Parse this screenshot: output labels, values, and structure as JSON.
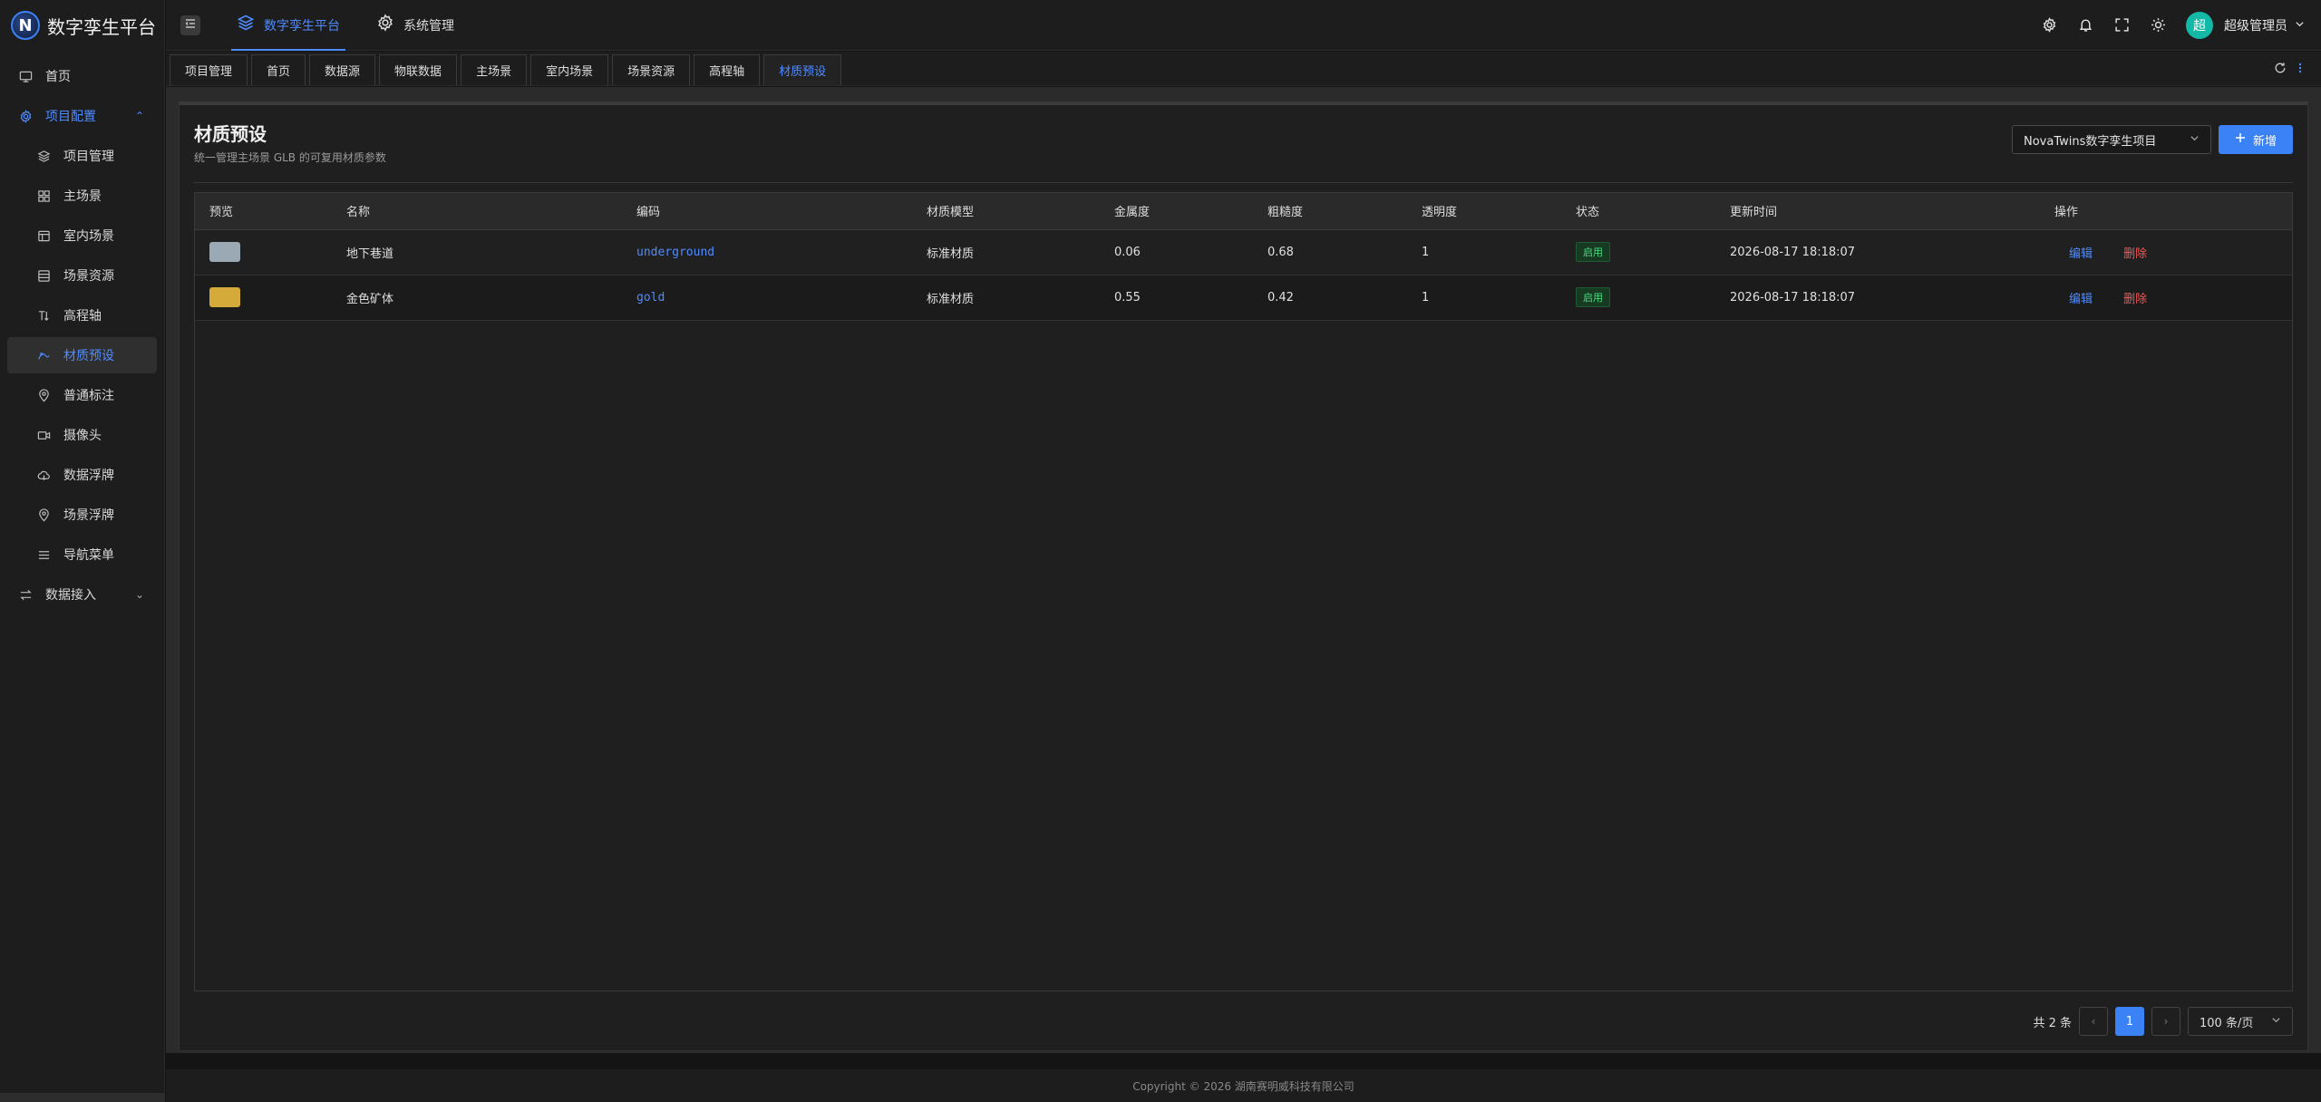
{
  "app": {
    "logo_letter": "N",
    "title": "数字孪生平台"
  },
  "sidebar": {
    "items": [
      {
        "label": "首页",
        "icon": "monitor-icon"
      },
      {
        "label": "项目配置",
        "icon": "gear-icon",
        "expanded": true,
        "arrow": "⌃"
      },
      {
        "label": "项目管理",
        "icon": "layers-icon"
      },
      {
        "label": "主场景",
        "icon": "grid-icon"
      },
      {
        "label": "室内场景",
        "icon": "building-icon"
      },
      {
        "label": "场景资源",
        "icon": "list-icon"
      },
      {
        "label": "高程轴",
        "icon": "elevation-icon"
      },
      {
        "label": "材质预设",
        "icon": "palette-icon"
      },
      {
        "label": "普通标注",
        "icon": "pin-icon"
      },
      {
        "label": "摄像头",
        "icon": "camera-icon"
      },
      {
        "label": "数据浮牌",
        "icon": "cloud-icon"
      },
      {
        "label": "场景浮牌",
        "icon": "pin-icon"
      },
      {
        "label": "导航菜单",
        "icon": "menu-icon"
      },
      {
        "label": "数据接入",
        "icon": "swap-icon",
        "arrow": "⌄"
      }
    ]
  },
  "header": {
    "tabs": [
      {
        "label": "数字孪生平台",
        "icon": "layers-icon"
      },
      {
        "label": "系统管理",
        "icon": "gear-icon"
      }
    ],
    "avatar_text": "超",
    "user_name": "超级管理员",
    "accent": "#3b82f6"
  },
  "page_tabs": [
    "项目管理",
    "首页",
    "数据源",
    "物联数据",
    "主场景",
    "室内场景",
    "场景资源",
    "高程轴",
    "材质预设"
  ],
  "card": {
    "title": "材质预设",
    "subtitle": "统一管理主场景 GLB 的可复用材质参数",
    "project_select": "NovaTwins数字孪生项目",
    "add_label": "新增"
  },
  "table": {
    "columns": [
      "预览",
      "名称",
      "编码",
      "材质模型",
      "金属度",
      "粗糙度",
      "透明度",
      "状态",
      "更新时间",
      "操作"
    ],
    "rows": [
      {
        "color": "#9aa9b4",
        "name": "地下巷道",
        "code": "underground",
        "model": "标准材质",
        "metalness": "0.06",
        "roughness": "0.68",
        "opacity": "1",
        "status": "启用",
        "updated": "2026-08-17 18:18:07",
        "edit": "编辑",
        "delete": "删除"
      },
      {
        "color": "#d4aa3a",
        "name": "金色矿体",
        "code": "gold",
        "model": "标准材质",
        "metalness": "0.55",
        "roughness": "0.42",
        "opacity": "1",
        "status": "启用",
        "updated": "2026-08-17 18:18:07",
        "edit": "编辑",
        "delete": "删除"
      }
    ]
  },
  "pager": {
    "total": "共 2 条",
    "page": "1",
    "size": "100 条/页"
  },
  "footer": "Copyright © 2026 湖南赛明威科技有限公司"
}
